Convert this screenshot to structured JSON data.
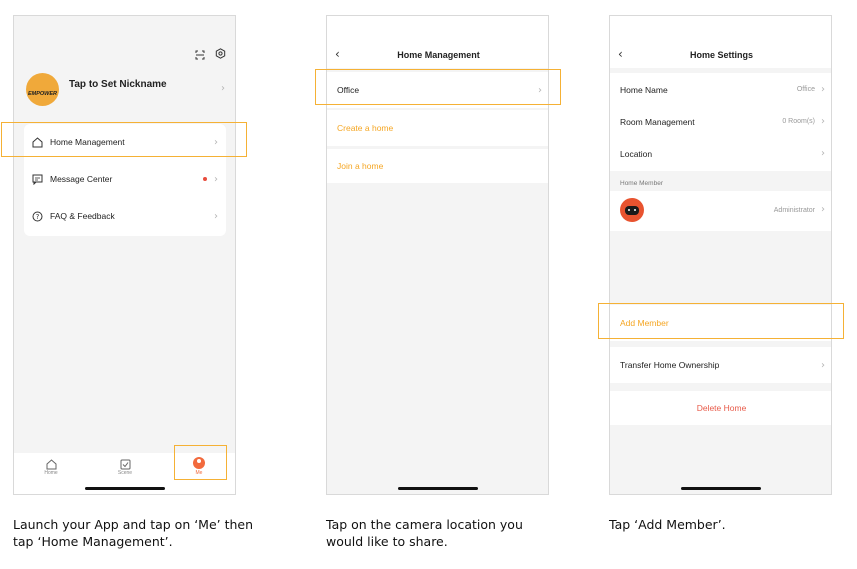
{
  "screen1": {
    "profile_name": "Tap to Set Nickname",
    "avatar_text": "EMPOWER",
    "menu": [
      {
        "label": "Home Management"
      },
      {
        "label": "Message Center"
      },
      {
        "label": "FAQ & Feedback"
      }
    ],
    "tabs": [
      {
        "label": "Home"
      },
      {
        "label": "Scene"
      },
      {
        "label": "Me"
      }
    ],
    "caption": "Launch your App and tap on ‘Me’ then tap ‘Home Management’."
  },
  "screen2": {
    "title": "Home Management",
    "home_item": "Office",
    "create_home": "Create a home",
    "join_home": "Join a home",
    "caption": "Tap on the camera location you would like to share."
  },
  "screen3": {
    "title": "Home Settings",
    "rows": [
      {
        "label": "Home Name",
        "value": "Office"
      },
      {
        "label": "Room Management",
        "value": "0 Room(s)"
      },
      {
        "label": "Location",
        "value": ""
      }
    ],
    "section_label": "Home Member",
    "member_role": "Administrator",
    "add_member": "Add Member",
    "transfer": "Transfer Home Ownership",
    "delete": "Delete Home",
    "caption": "Tap ‘Add Member’."
  },
  "colors": {
    "accent": "#f5a623",
    "highlight": "#f5b135",
    "danger": "#e85b4a",
    "notification_dot": "#e84c3d"
  }
}
